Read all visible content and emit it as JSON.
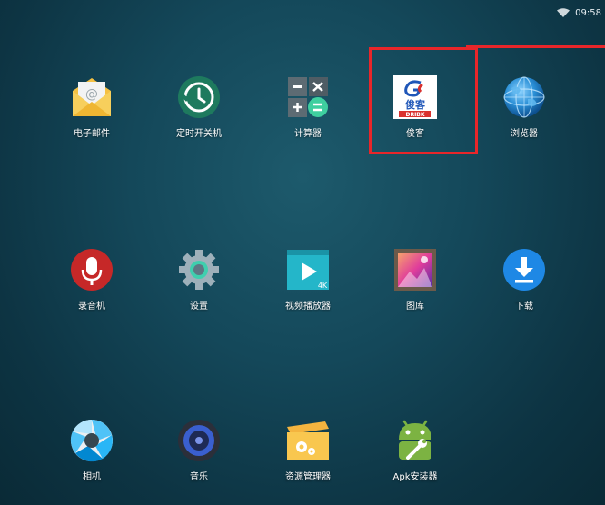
{
  "status": {
    "time": "09:58"
  },
  "apps": {
    "email": "电子邮件",
    "timer": "定时开关机",
    "calc": "计算器",
    "junke": "俊客",
    "junke_logo_text": "俊客",
    "junke_logo_brand": "DRIBK",
    "browser": "浏览器",
    "recorder": "录音机",
    "settings": "设置",
    "video": "视频播放器",
    "video_badge": "4K",
    "gallery": "图库",
    "download": "下载",
    "camera": "相机",
    "music": "音乐",
    "files": "资源管理器",
    "apk": "Apk安装器"
  },
  "colors": {
    "highlight": "#e8262a"
  }
}
